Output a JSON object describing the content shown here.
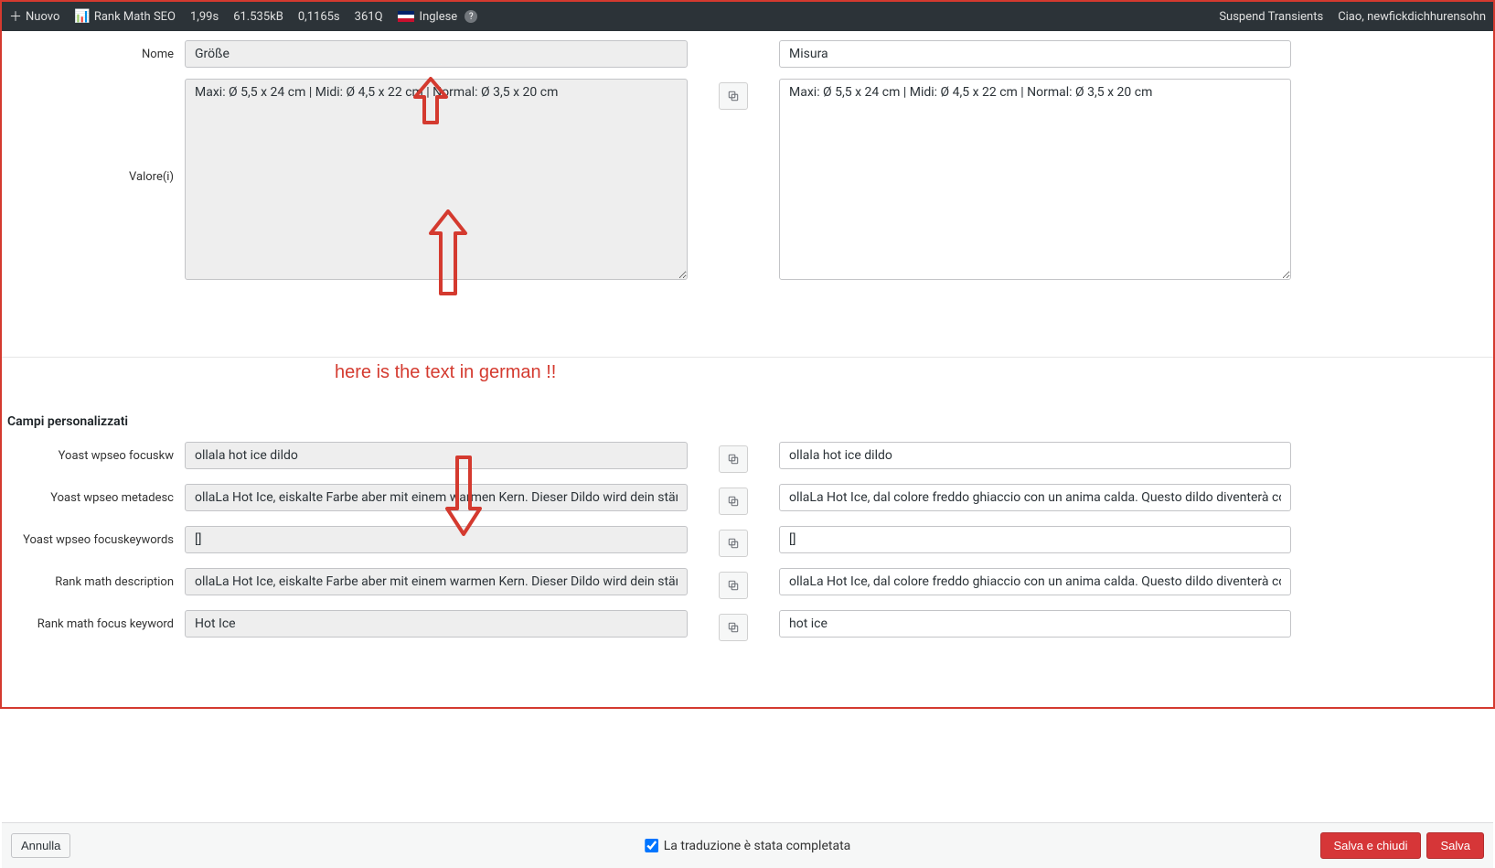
{
  "topbar": {
    "nuovo": "Nuovo",
    "rankmath": "Rank Math SEO",
    "time": "1,99s",
    "size": "61.535kB",
    "time2": "0,1165s",
    "queries": "361Q",
    "language": "Inglese",
    "suspend": "Suspend Transients",
    "greeting": "Ciao, newfickdichhurensohn"
  },
  "labels": {
    "nome": "Nome",
    "valore": "Valore(i)",
    "section_custom": "Campi personalizzati",
    "yoast_focuskw": "Yoast wpseo focuskw",
    "yoast_metadesc": "Yoast wpseo metadesc",
    "yoast_focuskeywords": "Yoast wpseo focuskeywords",
    "rankmath_desc": "Rank math description",
    "rankmath_focus": "Rank math focus keyword"
  },
  "fields": {
    "nome_left": "Größe",
    "nome_right": "Misura",
    "valore_left": "Maxi: Ø 5,5 x 24 cm | Midi: Ø 4,5 x 22 cm | Normal: Ø 3,5 x 20 cm",
    "valore_right": "Maxi: Ø 5,5 x 24 cm | Midi: Ø 4,5 x 22 cm | Normal: Ø 3,5 x 20 cm",
    "focuskw_left": "ollala hot ice dildo",
    "focuskw_right": "ollala hot ice dildo",
    "metadesc_left": "ollaLa Hot Ice, eiskalte Farbe aber mit einem warmen Kern. Dieser Dildo wird dein ständiger Begleiter",
    "metadesc_right": "ollaLa Hot Ice, dal colore freddo ghiaccio con un anima calda. Questo dildo diventerà compagno",
    "focuskeywords_left": "[]",
    "focuskeywords_right": "[]",
    "rankmath_desc_left": "ollaLa Hot Ice, eiskalte Farbe aber mit einem warmen Kern. Dieser Dildo wird dein ständiger Begleiter",
    "rankmath_desc_right": "ollaLa Hot Ice, dal colore freddo ghiaccio con un anima calda. Questo dildo diventerà compagno",
    "rankmath_focus_left": "Hot Ice",
    "rankmath_focus_right": "hot ice"
  },
  "annotation": {
    "text": "here is the text in german !!"
  },
  "footer": {
    "cancel": "Annulla",
    "checkbox_label": "La traduzione è stata completata",
    "save_close": "Salva e chiudi",
    "save": "Salva"
  }
}
